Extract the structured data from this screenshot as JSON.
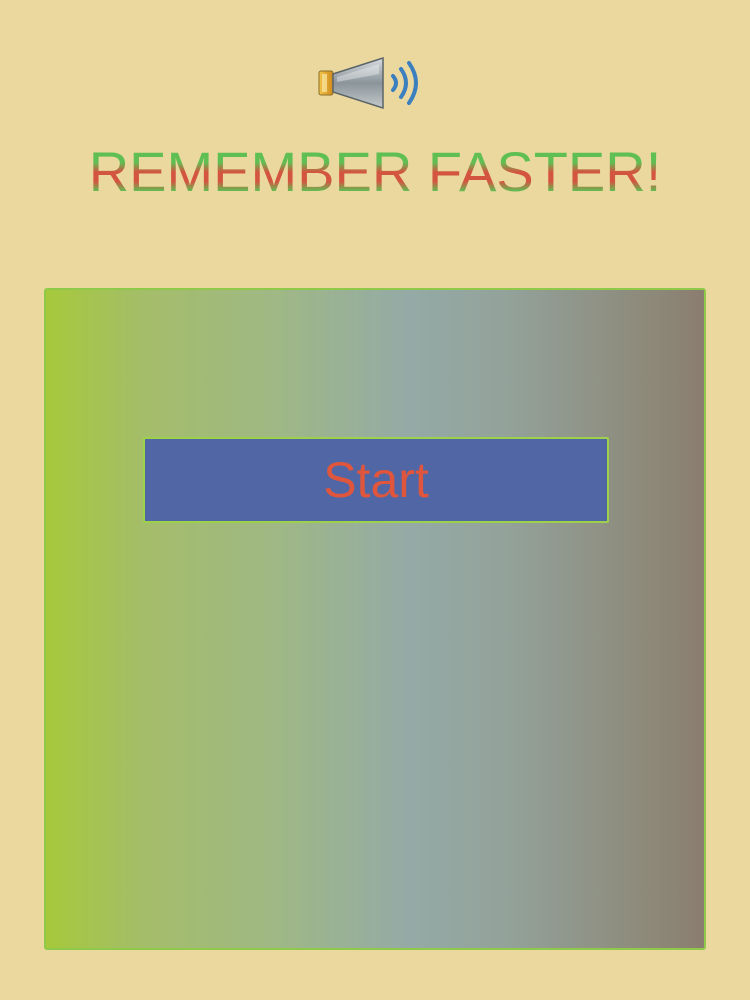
{
  "title": "REMEMBER FASTER!",
  "start_button": {
    "label": "Start"
  },
  "icons": {
    "sound": "speaker-sound-on-icon"
  },
  "colors": {
    "background": "#ead89f",
    "title_green": "#5fbf52",
    "title_red": "#d4553f",
    "button_fill": "#5166a4",
    "button_text": "#e0563d",
    "board_border": "#8fc94a"
  }
}
